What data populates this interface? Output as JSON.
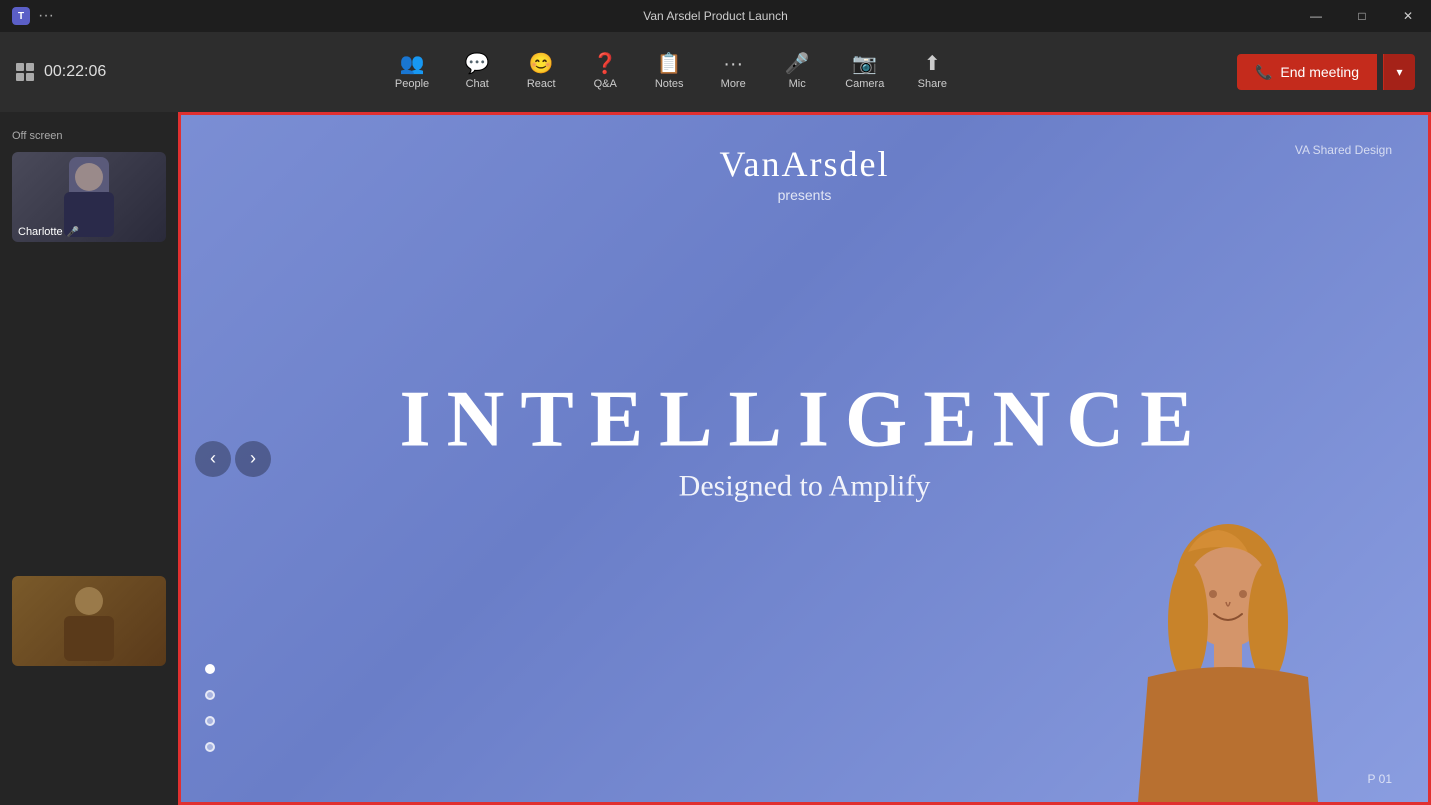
{
  "titlebar": {
    "app_name": "T",
    "meeting_title": "Van Arsdel Product Launch",
    "dots_label": "···",
    "minimize": "—",
    "maximize": "□",
    "close": "✕"
  },
  "toolbar": {
    "timer": "00:22:06",
    "buttons": [
      {
        "id": "people",
        "label": "People",
        "icon": "👥"
      },
      {
        "id": "chat",
        "label": "Chat",
        "icon": "💬"
      },
      {
        "id": "react",
        "label": "React",
        "icon": "😊"
      },
      {
        "id": "qa",
        "label": "Q&A",
        "icon": "❓"
      },
      {
        "id": "notes",
        "label": "Notes",
        "icon": "📋"
      },
      {
        "id": "more",
        "label": "More",
        "icon": "···"
      },
      {
        "id": "mic",
        "label": "Mic",
        "icon": "🎤"
      },
      {
        "id": "camera",
        "label": "Camera",
        "icon": "📷"
      },
      {
        "id": "share",
        "label": "Share",
        "icon": "↑"
      }
    ],
    "end_meeting_label": "End meeting",
    "end_phone_icon": "📞"
  },
  "sidebar": {
    "off_screen_label": "Off screen",
    "participants": [
      {
        "name": "Charlotte",
        "has_mic_off": true
      },
      {
        "name": ""
      }
    ]
  },
  "slide": {
    "brand_name": "VanArsdel",
    "brand_presents": "presents",
    "va_label": "VA Shared Design",
    "heading": "INTELLIGENCE",
    "subheading": "Designed to Amplify",
    "page_num": "P 01",
    "nav": {
      "prev": "‹",
      "next": "›"
    },
    "dots": [
      {
        "active": true
      },
      {
        "active": false
      },
      {
        "active": false
      },
      {
        "active": false
      }
    ]
  }
}
